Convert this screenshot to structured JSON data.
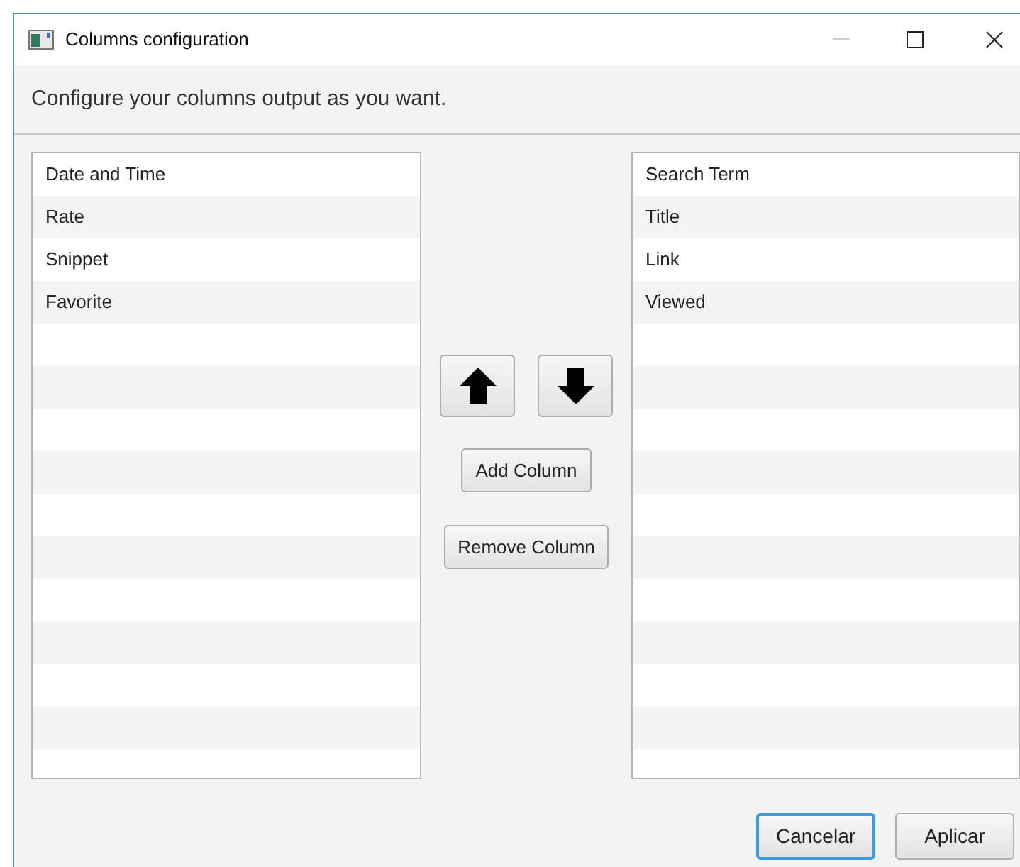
{
  "window": {
    "title": "Columns configuration"
  },
  "header": {
    "text": "Configure your columns output as you want."
  },
  "available_columns": [
    {
      "label": "Date and Time"
    },
    {
      "label": "Rate"
    },
    {
      "label": "Snippet"
    },
    {
      "label": "Favorite"
    }
  ],
  "middle_buttons": [
    {
      "kind": "up"
    },
    {
      "kind": "down"
    },
    {
      "kind": "text",
      "label": "Add Column"
    },
    {
      "kind": "text",
      "label": "Remove Column"
    }
  ],
  "selected_columns": [
    {
      "label": "Search Term"
    },
    {
      "label": "Title"
    },
    {
      "label": "Link"
    },
    {
      "label": "Viewed"
    }
  ],
  "footer_buttons": [
    {
      "label": "Cancelar",
      "default": true
    },
    {
      "label": "Aplicar",
      "default": false
    }
  ]
}
